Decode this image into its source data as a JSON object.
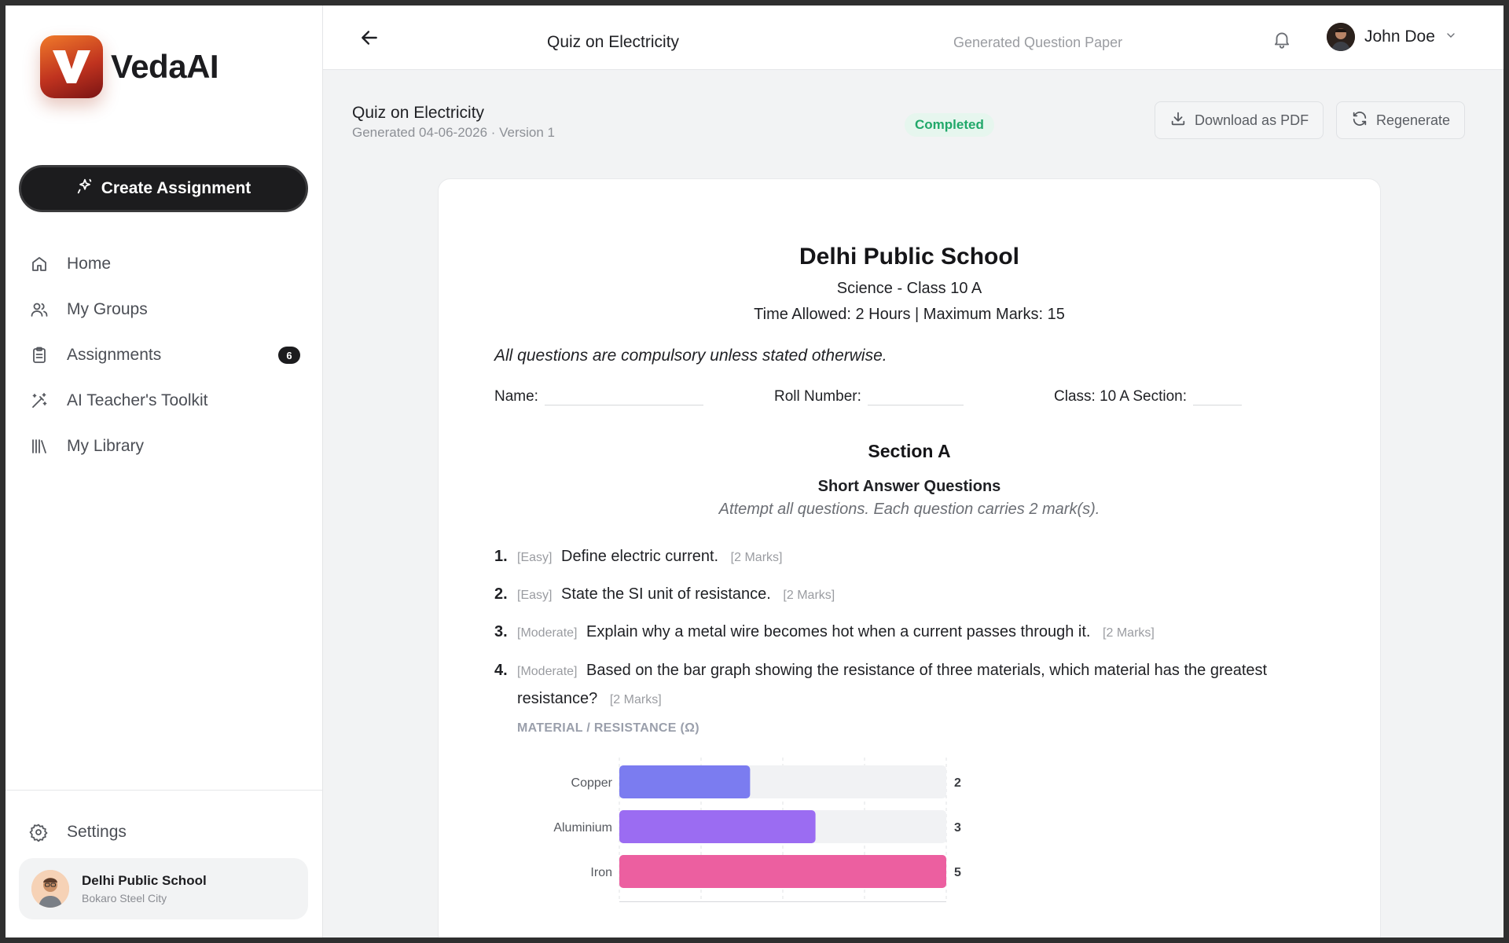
{
  "brand": {
    "name": "VedaAI"
  },
  "sidebar": {
    "create_label": "Create Assignment",
    "items": [
      {
        "label": "Home",
        "icon": "home-icon"
      },
      {
        "label": "My Groups",
        "icon": "users-icon"
      },
      {
        "label": "Assignments",
        "icon": "clipboard-icon",
        "badge": "6"
      },
      {
        "label": "AI Teacher's Toolkit",
        "icon": "magic-wand-icon"
      },
      {
        "label": "My Library",
        "icon": "library-icon"
      }
    ],
    "settings_label": "Settings",
    "school": {
      "name": "Delhi Public School",
      "city": "Bokaro Steel City"
    }
  },
  "topbar": {
    "title": "Quiz on Electricity",
    "subtitle": "Generated Question Paper",
    "user_name": "John Doe"
  },
  "header": {
    "title": "Quiz on Electricity",
    "meta": "Generated 04-06-2026 · Version 1",
    "status": "Completed",
    "download_label": "Download as PDF",
    "regenerate_label": "Regenerate"
  },
  "paper": {
    "school": "Delhi Public School",
    "class_line": "Science - Class 10 A",
    "time_line": "Time Allowed: 2 Hours | Maximum Marks: 15",
    "instruction": "All questions are compulsory unless stated otherwise.",
    "fields": {
      "name": "Name:",
      "roll": "Roll Number:",
      "class_section": "Class: 10 A Section:"
    },
    "section": {
      "title": "Section A",
      "type": "Short Answer Questions",
      "instruction": "Attempt all questions. Each question carries 2 mark(s)."
    },
    "questions": [
      {
        "num": "1.",
        "difficulty": "[Easy]",
        "text": "Define electric current.",
        "marks": "[2 Marks]"
      },
      {
        "num": "2.",
        "difficulty": "[Easy]",
        "text": "State the SI unit of resistance.",
        "marks": "[2 Marks]"
      },
      {
        "num": "3.",
        "difficulty": "[Moderate]",
        "text": "Explain why a metal wire becomes hot when a current passes through it.",
        "marks": "[2 Marks]"
      },
      {
        "num": "4.",
        "difficulty": "[Moderate]",
        "text": "Based on the bar graph showing the resistance of three materials, which material has the greatest resistance?",
        "marks": "[2 Marks]"
      }
    ]
  },
  "chart_data": {
    "type": "bar",
    "orientation": "horizontal",
    "title": "MATERIAL / RESISTANCE (Ω)",
    "categories": [
      "Copper",
      "Aluminium",
      "Iron"
    ],
    "values": [
      2,
      3,
      5
    ],
    "colors": [
      "#7b7cf0",
      "#9b6cf2",
      "#ec5fa0"
    ],
    "xlim": [
      0,
      5
    ],
    "grid": true
  },
  "colors": {
    "accent_dark": "#1c1c1e",
    "status_green": "#21a86a"
  }
}
